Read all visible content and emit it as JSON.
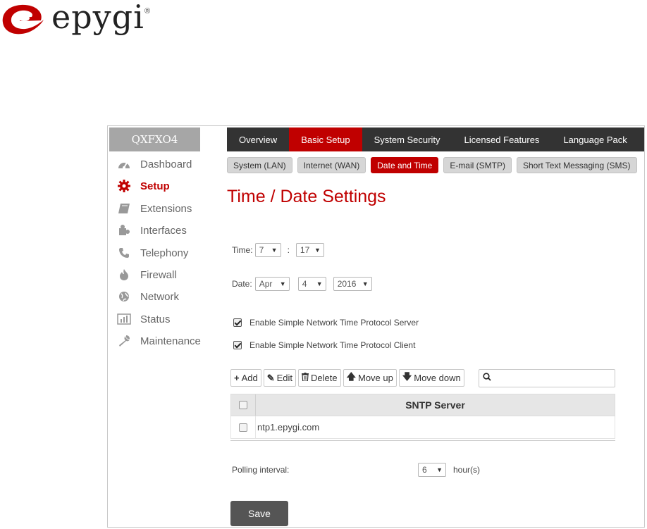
{
  "brand": {
    "name": "epygi",
    "registered": "®",
    "accent": "#c00000"
  },
  "sidebar": {
    "device_name": "QXFXO4",
    "items": [
      {
        "label": "Dashboard",
        "icon": "dashboard-icon"
      },
      {
        "label": "Setup",
        "icon": "gear-icon",
        "active": true
      },
      {
        "label": "Extensions",
        "icon": "book-icon"
      },
      {
        "label": "Interfaces",
        "icon": "puzzle-icon"
      },
      {
        "label": "Telephony",
        "icon": "phone-icon"
      },
      {
        "label": "Firewall",
        "icon": "flame-icon"
      },
      {
        "label": "Network",
        "icon": "globe-icon"
      },
      {
        "label": "Status",
        "icon": "bar-chart-icon"
      },
      {
        "label": "Maintenance",
        "icon": "wrench-icon"
      }
    ]
  },
  "tabs": [
    {
      "label": "Overview"
    },
    {
      "label": "Basic Setup",
      "active": true
    },
    {
      "label": "System Security"
    },
    {
      "label": "Licensed Features"
    },
    {
      "label": "Language Pack"
    }
  ],
  "subtabs": [
    {
      "label": "System (LAN)"
    },
    {
      "label": "Internet (WAN)"
    },
    {
      "label": "Date and Time",
      "active": true
    },
    {
      "label": "E-mail (SMTP)"
    },
    {
      "label": "Short Text Messaging (SMS)"
    }
  ],
  "page_title": "Time / Date Settings",
  "time": {
    "label": "Time:",
    "hour": "7",
    "separator": ":",
    "minute": "17"
  },
  "date": {
    "label": "Date:",
    "month": "Apr",
    "day": "4",
    "year": "2016"
  },
  "options": {
    "sntp_server": {
      "label": "Enable Simple Network Time Protocol Server",
      "checked": true
    },
    "sntp_client": {
      "label": "Enable Simple Network Time Protocol Client",
      "checked": true
    }
  },
  "toolbar": {
    "add": "Add",
    "edit": "Edit",
    "delete": "Delete",
    "move_up": "Move up",
    "move_down": "Move down",
    "search_value": ""
  },
  "table": {
    "header": "SNTP Server",
    "rows": [
      {
        "server": "ntp1.epygi.com"
      }
    ]
  },
  "polling": {
    "label": "Polling interval:",
    "value": "6",
    "unit": "hour(s)"
  },
  "save_label": "Save"
}
